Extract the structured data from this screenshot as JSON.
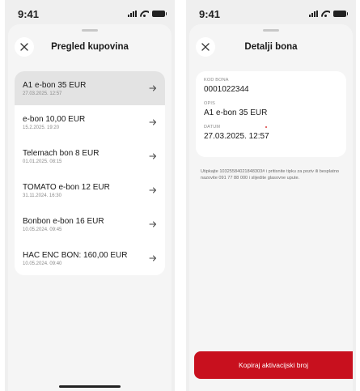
{
  "status_bar": {
    "time": "9:41"
  },
  "purchases_screen": {
    "title": "Pregled kupovina",
    "items": [
      {
        "title": "A1 e-bon 35 EUR",
        "date": "27.03.2025. 12:57",
        "selected": true
      },
      {
        "title": "e-bon 10,00 EUR",
        "date": "15.2.2025. 19:20",
        "selected": false
      },
      {
        "title": "Telemach bon 8 EUR",
        "date": "01.01.2025. 08:15",
        "selected": false
      },
      {
        "title": "TOMATO e-bon 12 EUR",
        "date": "31.11.2024. 16:30",
        "selected": false
      },
      {
        "title": "Bonbon e-bon 16 EUR",
        "date": "10.05.2024. 09:45",
        "selected": false
      },
      {
        "title": "HAC ENC BON: 160,00 EUR",
        "date": "10.05.2024. 09:40",
        "selected": false
      }
    ]
  },
  "detail_screen": {
    "title": "Detalji bona",
    "code_label": "KOD BONA",
    "code_value": "0001022344",
    "desc_label": "OPIS",
    "desc_value": "A1 e-bon 35 EUR",
    "date_label": "DATUM",
    "date_value": "27.03.2025. 12:57",
    "info_text": "Utipkajte 1032558402184830​3# i pritisnite tipku za poziv ili besplatno nazovite 091 77 88 000 i slijedite glasovne upute.",
    "cta_label": "Kopiraj aktivacijski broj"
  },
  "colors": {
    "accent": "#c8101e",
    "background": "#efefef",
    "card": "#ffffff",
    "selected_row": "#e3e3e3"
  },
  "icons": {
    "close": "close-icon",
    "row_arrow": "arrow-right-icon"
  }
}
